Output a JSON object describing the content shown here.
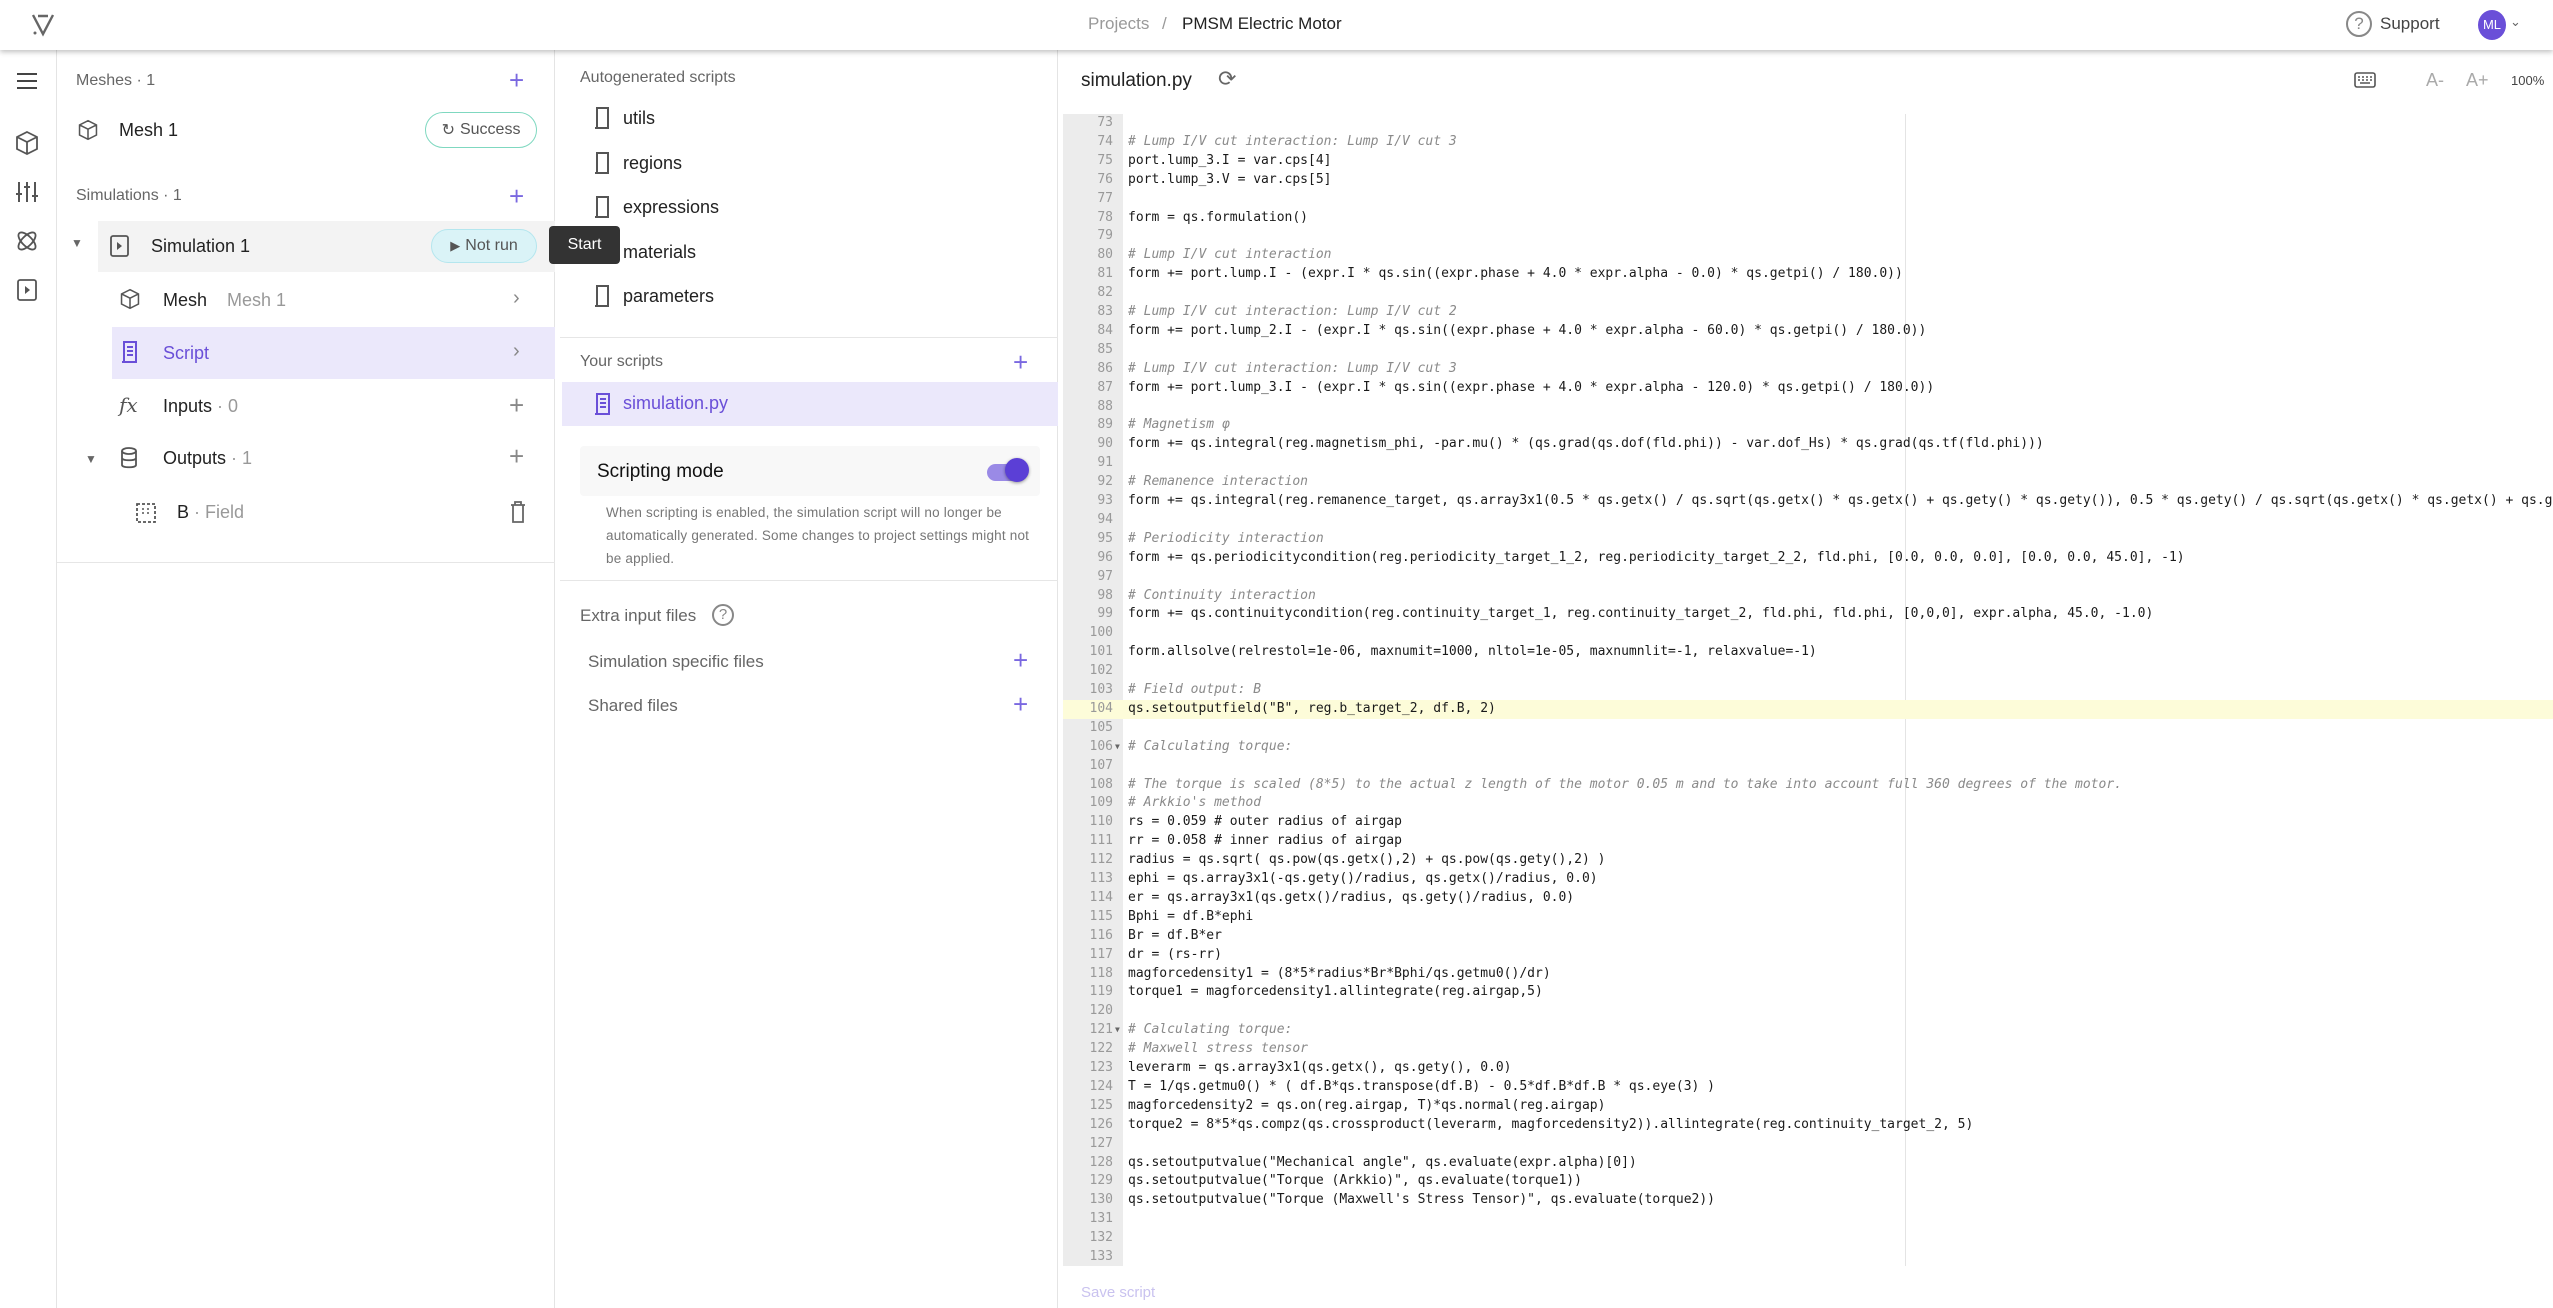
{
  "topbar": {
    "breadcrumb_root": "Projects",
    "breadcrumb_sep": "/",
    "project": "PMSM Electric Motor",
    "support": "Support",
    "avatar": "ML"
  },
  "rail": {
    "icons": [
      "menu-icon",
      "cube-icon",
      "sliders-icon",
      "atom-icon",
      "play-box-icon"
    ]
  },
  "left": {
    "meshes_label": "Meshes",
    "meshes_count": "1",
    "mesh_name": "Mesh 1",
    "mesh_status": "Success",
    "simulations_label": "Simulations",
    "simulations_count": "1",
    "simulation_name": "Simulation 1",
    "simulation_status": "Not run",
    "tooltip": "Start",
    "children": {
      "mesh_label": "Mesh",
      "mesh_value": "Mesh 1",
      "script_label": "Script",
      "inputs_label": "Inputs",
      "inputs_count": "0",
      "outputs_label": "Outputs",
      "outputs_count": "1",
      "output_name": "B",
      "output_type": "Field"
    }
  },
  "mid": {
    "autogen_header": "Autogenerated scripts",
    "autogen": [
      "utils",
      "regions",
      "expressions",
      "materials",
      "parameters"
    ],
    "your_header": "Your scripts",
    "your_scripts": [
      "simulation.py"
    ],
    "scripting_mode_label": "Scripting mode",
    "scripting_mode_on": true,
    "scripting_desc": "When scripting is enabled, the simulation script will no longer be automatically generated. Some changes to project settings might not be applied.",
    "extra_header": "Extra input files",
    "sim_files": "Simulation specific files",
    "shared_files": "Shared files"
  },
  "editor": {
    "filename": "simulation.py",
    "font_dec": "A-",
    "font_inc": "A+",
    "zoom": "100%",
    "save": "Save script",
    "first_line": 73,
    "highlighted_line": 104,
    "folded_lines": [
      106,
      121
    ],
    "lines": [
      "",
      "# Lump I/V cut interaction: Lump I/V cut 3",
      "port.lump_3.I = var.cps[4]",
      "port.lump_3.V = var.cps[5]",
      "",
      "form = qs.formulation()",
      "",
      "# Lump I/V cut interaction",
      "form += port.lump.I - (expr.I * qs.sin((expr.phase + 4.0 * expr.alpha - 0.0) * qs.getpi() / 180.0))",
      "",
      "# Lump I/V cut interaction: Lump I/V cut 2",
      "form += port.lump_2.I - (expr.I * qs.sin((expr.phase + 4.0 * expr.alpha - 60.0) * qs.getpi() / 180.0))",
      "",
      "# Lump I/V cut interaction: Lump I/V cut 3",
      "form += port.lump_3.I - (expr.I * qs.sin((expr.phase + 4.0 * expr.alpha - 120.0) * qs.getpi() / 180.0))",
      "",
      "# Magnetism φ",
      "form += qs.integral(reg.magnetism_phi, -par.mu() * (qs.grad(qs.dof(fld.phi)) - var.dof_Hs) * qs.grad(qs.tf(fld.phi)))",
      "",
      "# Remanence interaction",
      "form += qs.integral(reg.remanence_target, qs.array3x1(0.5 * qs.getx() / qs.sqrt(qs.getx() * qs.getx() + qs.gety() * qs.gety()), 0.5 * qs.gety() / qs.sqrt(qs.getx() * qs.getx() + qs.ge",
      "",
      "# Periodicity interaction",
      "form += qs.periodicitycondition(reg.periodicity_target_1_2, reg.periodicity_target_2_2, fld.phi, [0.0, 0.0, 0.0], [0.0, 0.0, 45.0], -1)",
      "",
      "# Continuity interaction",
      "form += qs.continuitycondition(reg.continuity_target_1, reg.continuity_target_2, fld.phi, fld.phi, [0,0,0], expr.alpha, 45.0, -1.0)",
      "",
      "form.allsolve(relrestol=1e-06, maxnumit=1000, nltol=1e-05, maxnumnlit=-1, relaxvalue=-1)",
      "",
      "# Field output: B",
      "qs.setoutputfield(\"B\", reg.b_target_2, df.B, 2)",
      "",
      "# Calculating torque:",
      "",
      "# The torque is scaled (8*5) to the actual z length of the motor 0.05 m and to take into account full 360 degrees of the motor.",
      "# Arkkio's method",
      "rs = 0.059 # outer radius of airgap",
      "rr = 0.058 # inner radius of airgap",
      "radius = qs.sqrt( qs.pow(qs.getx(),2) + qs.pow(qs.gety(),2) )",
      "ephi = qs.array3x1(-qs.gety()/radius, qs.getx()/radius, 0.0)",
      "er = qs.array3x1(qs.getx()/radius, qs.gety()/radius, 0.0)",
      "Bphi = df.B*ephi",
      "Br = df.B*er",
      "dr = (rs-rr)",
      "magforcedensity1 = (8*5*radius*Br*Bphi/qs.getmu0()/dr)",
      "torque1 = magforcedensity1.allintegrate(reg.airgap,5)",
      "",
      "# Calculating torque:",
      "# Maxwell stress tensor",
      "leverarm = qs.array3x1(qs.getx(), qs.gety(), 0.0)",
      "T = 1/qs.getmu0() * ( df.B*qs.transpose(df.B) - 0.5*df.B*df.B * qs.eye(3) )",
      "magforcedensity2 = qs.on(reg.airgap, T)*qs.normal(reg.airgap)",
      "torque2 = 8*5*qs.compz(qs.crossproduct(leverarm, magforcedensity2)).allintegrate(reg.continuity_target_2, 5)",
      "",
      "qs.setoutputvalue(\"Mechanical angle\", qs.evaluate(expr.alpha)[0])",
      "qs.setoutputvalue(\"Torque (Arkkio)\", qs.evaluate(torque1))",
      "qs.setoutputvalue(\"Torque (Maxwell's Stress Tensor)\", qs.evaluate(torque2))",
      "",
      "",
      ""
    ]
  },
  "colors": {
    "accent": "#6a4fd8",
    "selected_bg": "#ebe8fb",
    "success": "#7fd8c0",
    "not_run_bg": "#daf3f7"
  }
}
